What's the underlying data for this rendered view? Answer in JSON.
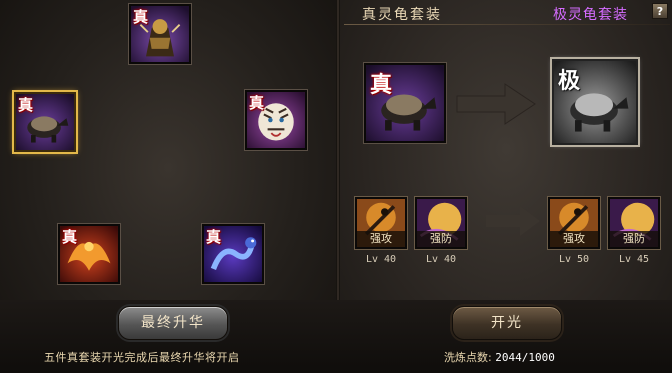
{
  "left_panel": {
    "slots": [
      {
        "id": "top",
        "badge": "真",
        "creature": "beast-warrior",
        "colors": [
          "#5a2f86",
          "#b48a3a"
        ]
      },
      {
        "id": "left",
        "badge": "真",
        "creature": "spirit-turtle",
        "colors": [
          "#4a2a70",
          "#222"
        ],
        "selected": true
      },
      {
        "id": "right",
        "badge": "真",
        "creature": "white-tiger",
        "colors": [
          "#7a3a8c",
          "#e8e0d2"
        ]
      },
      {
        "id": "bottom-left",
        "badge": "真",
        "creature": "vermilion-bird",
        "colors": [
          "#8a1e14",
          "#f29a2e"
        ]
      },
      {
        "id": "bottom-right",
        "badge": "真",
        "creature": "azure-dragon",
        "colors": [
          "#3a2a8c",
          "#7aa0ff"
        ]
      }
    ],
    "final_button_label": "最终升华",
    "tip_text": "五件真套装开光完成后最终升华将开启"
  },
  "right_panel": {
    "title_current": "真灵龟套装",
    "title_target": "极灵龟套装",
    "help_label": "?",
    "current_item": {
      "badge": "真",
      "creature": "spirit-turtle"
    },
    "target_item": {
      "badge": "极",
      "creature": "spirit-turtle-gray"
    },
    "skills_current": [
      {
        "label": "强攻",
        "level": "Lv 40",
        "icon": "sword-icon"
      },
      {
        "label": "强防",
        "level": "Lv 40",
        "icon": "shield-orb-icon"
      }
    ],
    "skills_target": [
      {
        "label": "强攻",
        "level": "Lv 50",
        "icon": "sword-icon"
      },
      {
        "label": "强防",
        "level": "Lv 45",
        "icon": "shield-orb-icon"
      }
    ],
    "open_button_label": "开光",
    "refine_label": "洗炼点数:",
    "refine_value": "2044/1000"
  }
}
